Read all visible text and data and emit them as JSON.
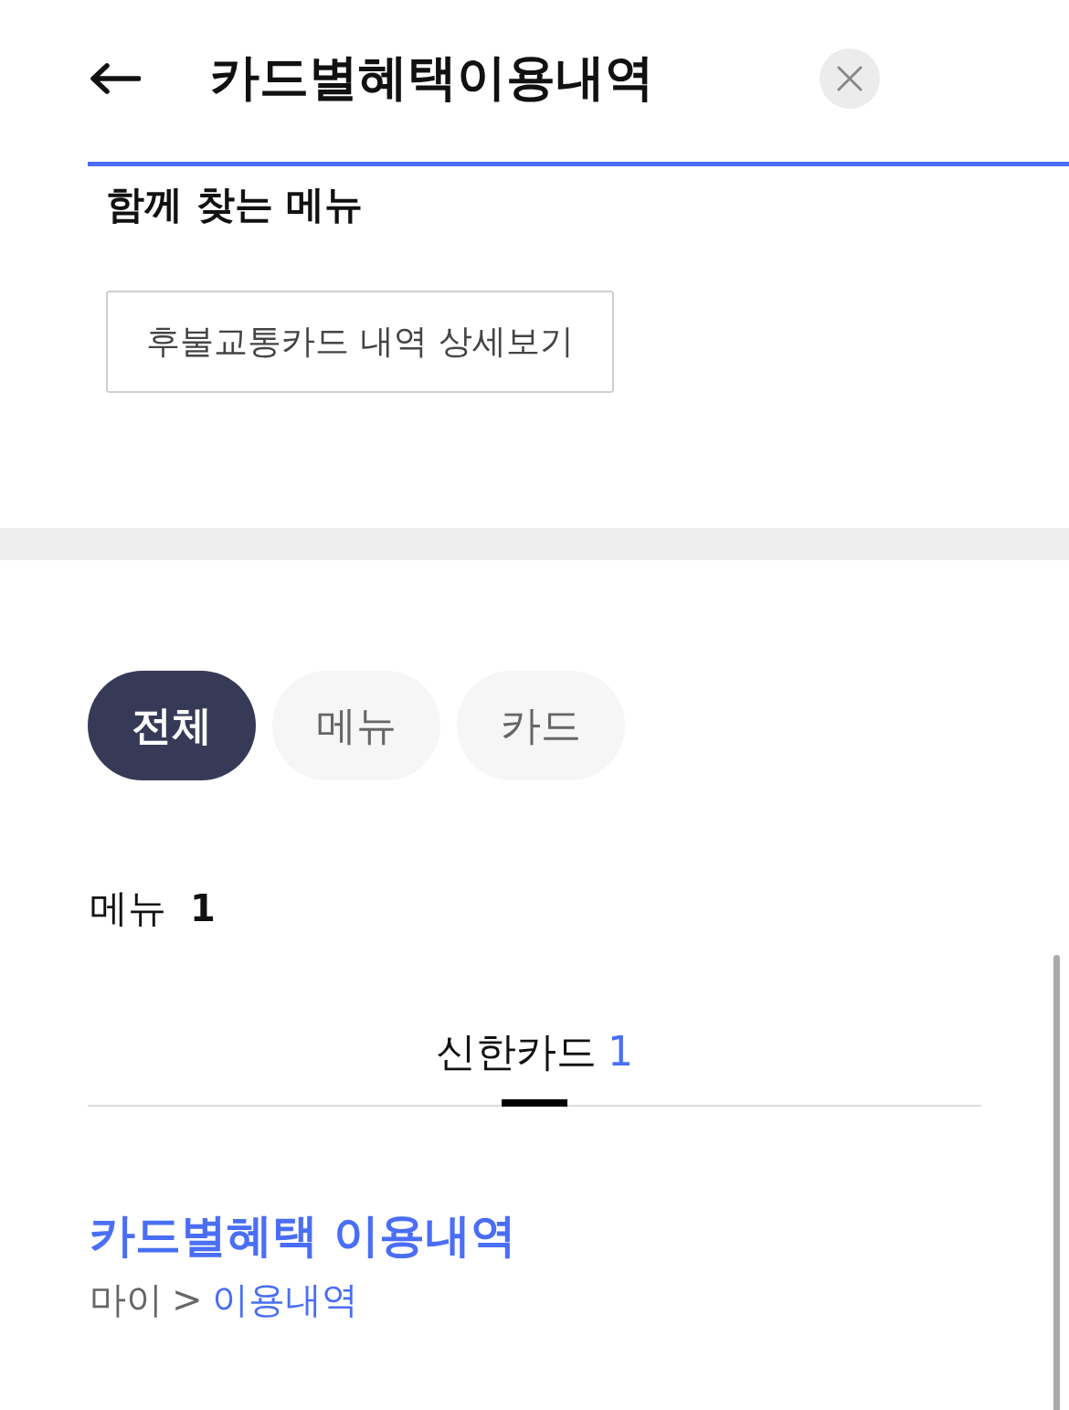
{
  "header": {
    "search": {
      "value": "카드별혜택이용내역"
    }
  },
  "related": {
    "title": "함께 찾는 메뉴",
    "links": [
      "후불교통카드 내역 상세보기"
    ]
  },
  "filters": [
    {
      "label": "전체",
      "selected": true
    },
    {
      "label": "메뉴",
      "selected": false
    },
    {
      "label": "카드",
      "selected": false
    }
  ],
  "results": {
    "label": "메뉴",
    "count": "1",
    "tabs": [
      {
        "label": "신한카드",
        "count": "1",
        "selected": true
      }
    ],
    "items": [
      {
        "title": "카드별혜택 이용내역",
        "breadcrumb": {
          "separator": ">",
          "items": [
            {
              "label": "마이",
              "kind": "text"
            },
            {
              "label": "이용내역",
              "kind": "link"
            }
          ]
        }
      }
    ]
  }
}
